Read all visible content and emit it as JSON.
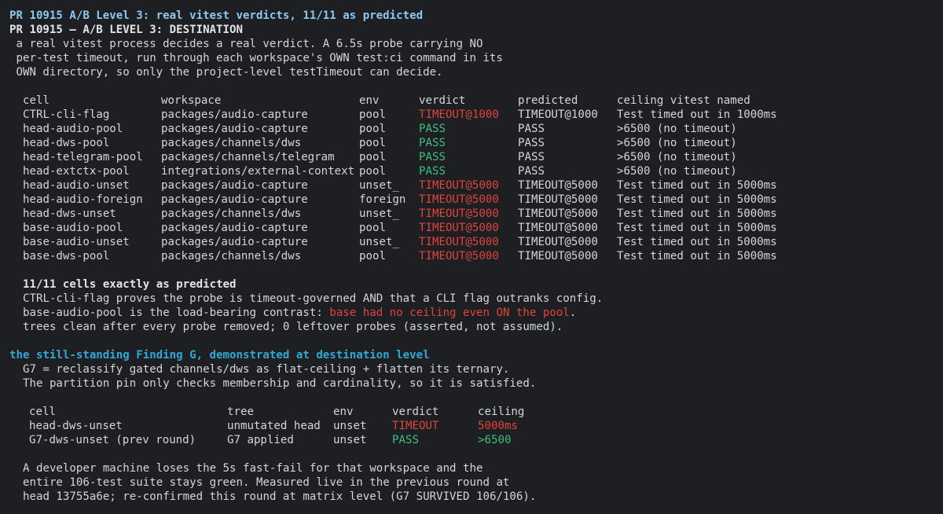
{
  "header": {
    "title": "PR 10915 A/B Level 3: real vitest verdicts, 11/11 as predicted",
    "subtitle": "PR 10915 — A/B LEVEL 3: DESTINATION"
  },
  "intro": [
    " a real vitest process decides a real verdict. A 6.5s probe carrying NO",
    " per-test timeout, run through each workspace's OWN test:ci command in its",
    " OWN directory, so only the project-level testTimeout can decide."
  ],
  "table": {
    "headers": [
      "cell",
      "workspace",
      "env",
      "verdict",
      "predicted",
      "ceiling vitest named"
    ],
    "rows": [
      {
        "cell": "CTRL-cli-flag",
        "workspace": "packages/audio-capture",
        "env": "pool",
        "verdict": "TIMEOUT@1000",
        "status": "fail",
        "predicted": "TIMEOUT@1000",
        "ceiling": "Test timed out in 1000ms"
      },
      {
        "cell": "head-audio-pool",
        "workspace": "packages/audio-capture",
        "env": "pool",
        "verdict": "PASS",
        "status": "pass",
        "predicted": "PASS",
        "ceiling": ">6500 (no timeout)"
      },
      {
        "cell": "head-dws-pool",
        "workspace": "packages/channels/dws",
        "env": "pool",
        "verdict": "PASS",
        "status": "pass",
        "predicted": "PASS",
        "ceiling": ">6500 (no timeout)"
      },
      {
        "cell": "head-telegram-pool",
        "workspace": "packages/channels/telegram",
        "env": "pool",
        "verdict": "PASS",
        "status": "pass",
        "predicted": "PASS",
        "ceiling": ">6500 (no timeout)"
      },
      {
        "cell": "head-extctx-pool",
        "workspace": "integrations/external-context",
        "env": "pool",
        "verdict": "PASS",
        "status": "pass",
        "predicted": "PASS",
        "ceiling": ">6500 (no timeout)"
      },
      {
        "cell": "head-audio-unset",
        "workspace": "packages/audio-capture",
        "env": "unset_",
        "verdict": "TIMEOUT@5000",
        "status": "fail",
        "predicted": "TIMEOUT@5000",
        "ceiling": "Test timed out in 5000ms"
      },
      {
        "cell": "head-audio-foreign",
        "workspace": "packages/audio-capture",
        "env": "foreign",
        "verdict": "TIMEOUT@5000",
        "status": "fail",
        "predicted": "TIMEOUT@5000",
        "ceiling": "Test timed out in 5000ms"
      },
      {
        "cell": "head-dws-unset",
        "workspace": "packages/channels/dws",
        "env": "unset_",
        "verdict": "TIMEOUT@5000",
        "status": "fail",
        "predicted": "TIMEOUT@5000",
        "ceiling": "Test timed out in 5000ms"
      },
      {
        "cell": "base-audio-pool",
        "workspace": "packages/audio-capture",
        "env": "pool",
        "verdict": "TIMEOUT@5000",
        "status": "fail",
        "predicted": "TIMEOUT@5000",
        "ceiling": "Test timed out in 5000ms"
      },
      {
        "cell": "base-audio-unset",
        "workspace": "packages/audio-capture",
        "env": "unset_",
        "verdict": "TIMEOUT@5000",
        "status": "fail",
        "predicted": "TIMEOUT@5000",
        "ceiling": "Test timed out in 5000ms"
      },
      {
        "cell": "base-dws-pool",
        "workspace": "packages/channels/dws",
        "env": "pool",
        "verdict": "TIMEOUT@5000",
        "status": "fail",
        "predicted": "TIMEOUT@5000",
        "ceiling": "Test timed out in 5000ms"
      }
    ]
  },
  "summary": {
    "heading": "11/11 cells exactly as predicted",
    "line1": "CTRL-cli-flag proves the probe is timeout-governed AND that a CLI flag outranks config.",
    "line2_prefix": "base-audio-pool is the load-bearing contrast: ",
    "line2_highlight": "base had no ceiling even ON the pool",
    "line2_suffix": ".",
    "line3": "trees clean after every probe removed; 0 leftover probes (asserted, not assumed)."
  },
  "finding": {
    "heading": "the still-standing Finding G, demonstrated at destination level",
    "desc": [
      "G7 = reclassify gated channels/dws as flat-ceiling + flatten its ternary.",
      "The partition pin only checks membership and cardinality, so it is satisfied."
    ],
    "table": {
      "headers": [
        "cell",
        "tree",
        "env",
        "verdict",
        "ceiling"
      ],
      "rows": [
        {
          "cell": "head-dws-unset",
          "tree": "unmutated head",
          "env": "unset",
          "verdict": "TIMEOUT",
          "ceiling": "5000ms",
          "status": "fail"
        },
        {
          "cell": "G7-dws-unset (prev round)",
          "tree": "G7 applied",
          "env": "unset",
          "verdict": "PASS",
          "ceiling": ">6500",
          "status": "pass"
        }
      ]
    },
    "closing": [
      "A developer machine loses the 5s fast-fail for that workspace and the",
      "entire 106-test suite stays green. Measured live in the previous round at",
      "head 13755a6e; re-confirmed this round at matrix level (G7 SURVIVED 106/106)."
    ]
  },
  "colors": {
    "background": "#1e1f22",
    "text": "#d4d6da",
    "title": "#8cc8f0",
    "section": "#31a8d8",
    "fail": "#e0443e",
    "pass": "#3fbf7f"
  }
}
